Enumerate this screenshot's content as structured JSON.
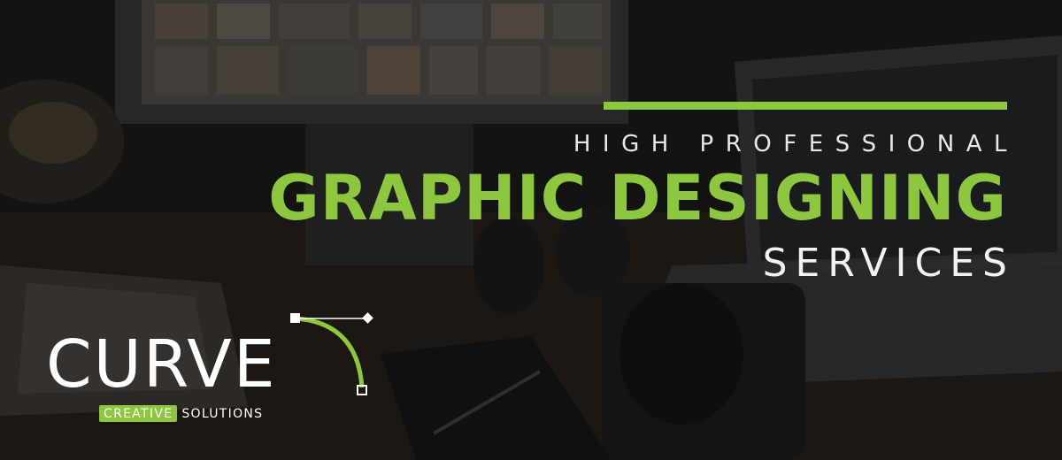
{
  "colors": {
    "accent": "#8dc63f",
    "headline_white": "#eeeeee"
  },
  "headline": {
    "line1": "HIGH PROFESSIONAL",
    "line2": "GRAPHIC DESIGNING",
    "line3": "SERVICES"
  },
  "logo": {
    "word": "CURVE",
    "sub_highlight": "CREATIVE",
    "sub_rest": "SOLUTIONS",
    "icon": "bezier-curve-icon"
  }
}
